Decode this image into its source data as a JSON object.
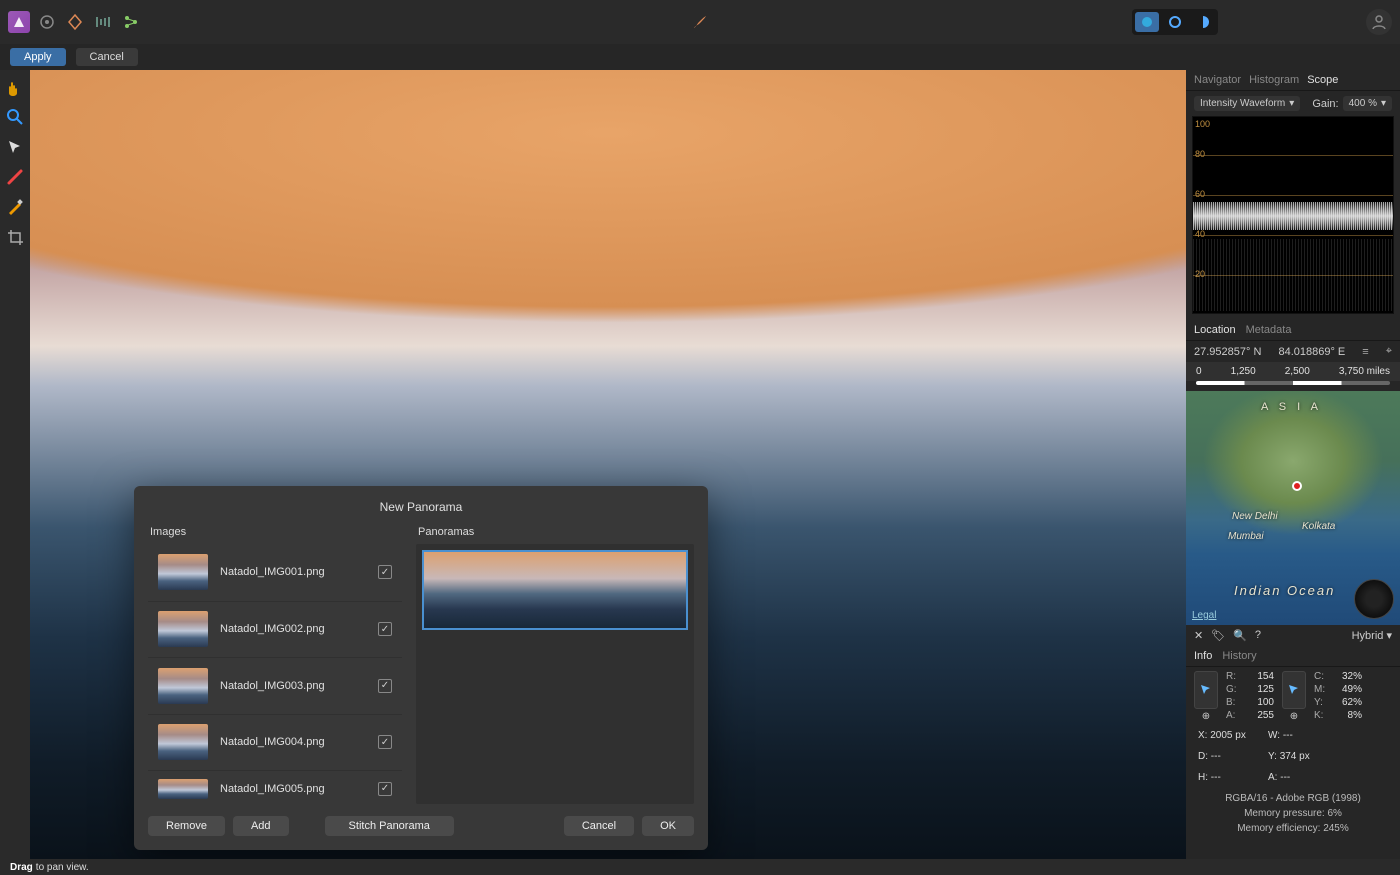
{
  "topbar": {
    "icons": [
      "app-icon",
      "circle-icon",
      "hex-icon",
      "bars-icon",
      "share-icon"
    ],
    "center_icon": "paintbrush-icon",
    "persona_icons": [
      "circle-blue-icon",
      "affinity-icon",
      "half-moon-icon"
    ],
    "account_icon": "person-icon"
  },
  "context": {
    "apply_label": "Apply",
    "cancel_label": "Cancel"
  },
  "tools": [
    "hand-tool",
    "zoom-tool",
    "move-tool",
    "brush-tool",
    "heal-tool",
    "crop-tool"
  ],
  "scope_panel": {
    "tabs": [
      "Navigator",
      "Histogram",
      "Scope"
    ],
    "active_tab": "Scope",
    "mode_label": "Intensity Waveform",
    "gain_label": "Gain:",
    "gain_value": "400 %",
    "y_ticks": [
      "100",
      "80",
      "60",
      "40",
      "20"
    ]
  },
  "location_panel": {
    "tabs": [
      "Location",
      "Metadata"
    ],
    "active_tab": "Location",
    "lat": "27.952857° N",
    "lon": "84.018869° E",
    "scale": [
      "0",
      "1,250",
      "2,500",
      "3,750 miles"
    ],
    "map_labels": {
      "asia": "A S I A",
      "delhi": "New Delhi",
      "mumbai": "Mumbai",
      "kolkata": "Kolkata",
      "ocean": "Indian  Ocean"
    },
    "legal": "Legal",
    "map_type": "Hybrid"
  },
  "map_tool_icons": [
    "clear-icon",
    "tag-icon",
    "search-icon",
    "help-icon"
  ],
  "info_panel": {
    "tabs": [
      "Info",
      "History"
    ],
    "active_tab": "Info",
    "rgba_labels": [
      "R:",
      "G:",
      "B:",
      "A:"
    ],
    "rgba_values": [
      "154",
      "125",
      "100",
      "255"
    ],
    "cmyk_labels": [
      "C:",
      "M:",
      "Y:",
      "K:"
    ],
    "cmyk_values": [
      "32%",
      "49%",
      "62%",
      "8%"
    ],
    "readout": {
      "x_label": "X:",
      "x": "2005 px",
      "y_label": "Y:",
      "y": "374 px",
      "w_label": "W:",
      "w": "---",
      "h_label": "H:",
      "h": "---",
      "d_label": "D:",
      "d": "---",
      "a_label": "A:",
      "a": "---"
    },
    "mode": "RGBA/16 - Adobe RGB (1998)",
    "mem_pressure_label": "Memory pressure:",
    "mem_pressure": "6%",
    "mem_eff_label": "Memory efficiency:",
    "mem_eff": "245%"
  },
  "statusbar": {
    "bold": "Drag",
    "text": "to pan view."
  },
  "dialog": {
    "title": "New Panorama",
    "images_header": "Images",
    "panoramas_header": "Panoramas",
    "images": [
      {
        "name": "Natadol_IMG001.png",
        "checked": true
      },
      {
        "name": "Natadol_IMG002.png",
        "checked": true
      },
      {
        "name": "Natadol_IMG003.png",
        "checked": true
      },
      {
        "name": "Natadol_IMG004.png",
        "checked": true
      },
      {
        "name": "Natadol_IMG005.png",
        "checked": true
      }
    ],
    "remove_label": "Remove",
    "add_label": "Add",
    "stitch_label": "Stitch Panorama",
    "cancel_label": "Cancel",
    "ok_label": "OK"
  }
}
